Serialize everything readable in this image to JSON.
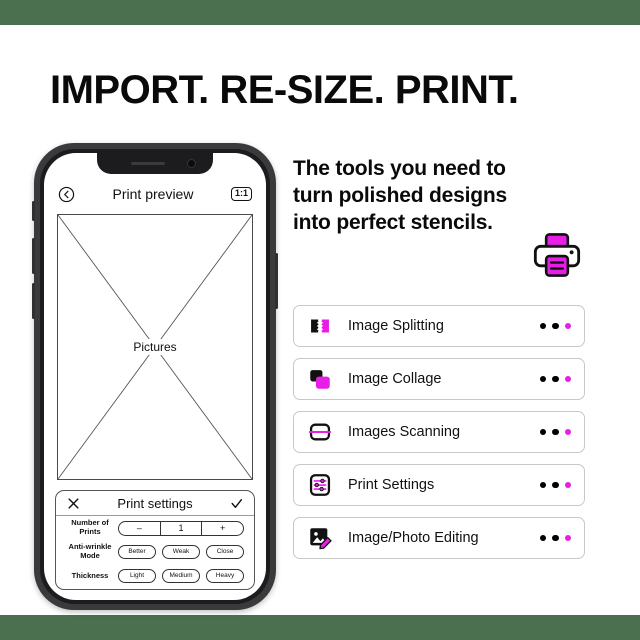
{
  "theme": {
    "band_color": "#4a7050",
    "accent_color": "#e61ee6",
    "text_color": "#0a0a0a"
  },
  "headline": "IMPORT. RE-SIZE. PRINT.",
  "right_panel": {
    "subheading": "The tools you need to turn polished designs into perfect stencils.",
    "printer_icon": "printer-icon"
  },
  "phone": {
    "app_header": {
      "back_icon": "back-chevron-icon",
      "title": "Print preview",
      "ratio_badge": "1:1"
    },
    "preview": {
      "placeholder_label": "Pictures"
    },
    "settings_panel": {
      "close_icon": "close-x-icon",
      "title": "Print settings",
      "confirm_icon": "checkmark-icon",
      "rows": [
        {
          "label": "Number of Prints",
          "type": "stepper",
          "decrement": "–",
          "value": "1",
          "increment": "+"
        },
        {
          "label": "Anti-wrinkle Mode",
          "type": "pills",
          "options": [
            "Better",
            "Weak",
            "Close"
          ]
        },
        {
          "label": "Thickness",
          "type": "pills",
          "options": [
            "Light",
            "Medium",
            "Heavy"
          ]
        }
      ]
    }
  },
  "features": [
    {
      "icon": "image-splitting-icon",
      "label": "Image Splitting",
      "dots": 3
    },
    {
      "icon": "image-collage-icon",
      "label": "Image Collage",
      "dots": 3
    },
    {
      "icon": "images-scanning-icon",
      "label": "Images Scanning",
      "dots": 3
    },
    {
      "icon": "print-settings-icon",
      "label": "Print Settings",
      "dots": 3
    },
    {
      "icon": "image-photo-editing-icon",
      "label": "Image/Photo Editing",
      "dots": 3
    }
  ]
}
